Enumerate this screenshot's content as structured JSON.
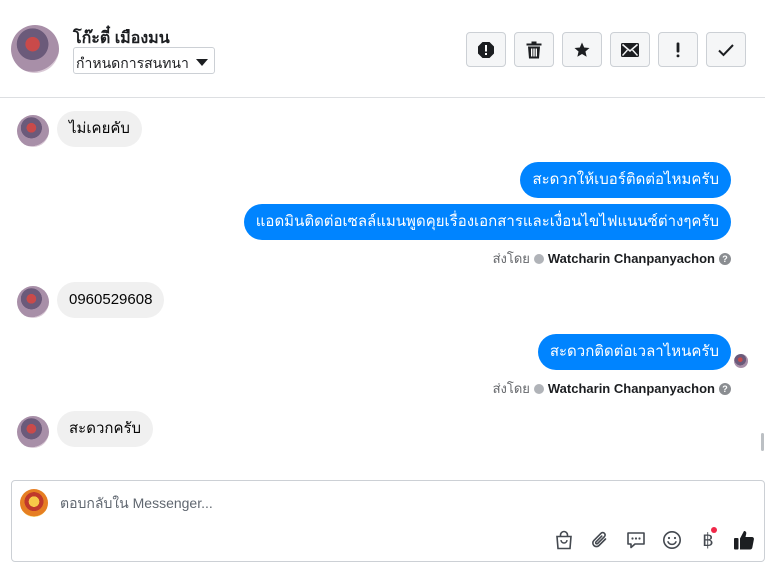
{
  "header": {
    "contact_name": "โก๊ะตี๋ เมืองมน",
    "label_select": "กำหนดการสนทนา",
    "tools": [
      {
        "icon": "spam-icon",
        "action": "mark-spam"
      },
      {
        "icon": "trash-icon",
        "action": "delete"
      },
      {
        "icon": "star-icon",
        "action": "follow-up"
      },
      {
        "icon": "envelope-icon",
        "action": "mark-unread"
      },
      {
        "icon": "exclamation-icon",
        "action": "mark-important"
      },
      {
        "icon": "check-icon",
        "action": "mark-done"
      }
    ]
  },
  "thread": {
    "messages": [
      {
        "direction": "in",
        "text": "ไม่เคยคับ"
      },
      {
        "direction": "out",
        "text": "สะดวกให้เบอร์ติดต่อไหมครับ"
      },
      {
        "direction": "out",
        "text": "แอดมินติดต่อเซลล์แมนพูดคุยเรื่องเอกสารและเงื่อนไขไฟแนนซ์ต่างๆครับ"
      },
      {
        "direction": "in",
        "text": "0960529608"
      },
      {
        "direction": "out",
        "text": "สะดวกติดต่อเวลาไหนครับ"
      },
      {
        "direction": "in",
        "text": "สะดวกครับ"
      }
    ],
    "sent_by_prefix": "ส่งโดย",
    "sent_by_name": "Watcharin Chanpanyachon",
    "help_glyph": "?"
  },
  "composer": {
    "placeholder": "ตอบกลับใน Messenger...",
    "value": "",
    "icons": [
      "shop-bag-icon",
      "paperclip-icon",
      "saved-replies-icon",
      "emoji-icon",
      "baht-payment-icon",
      "thumbs-up-icon"
    ],
    "baht_glyph": "฿",
    "accent": "#0084ff",
    "notification_dot": "#f02849"
  }
}
